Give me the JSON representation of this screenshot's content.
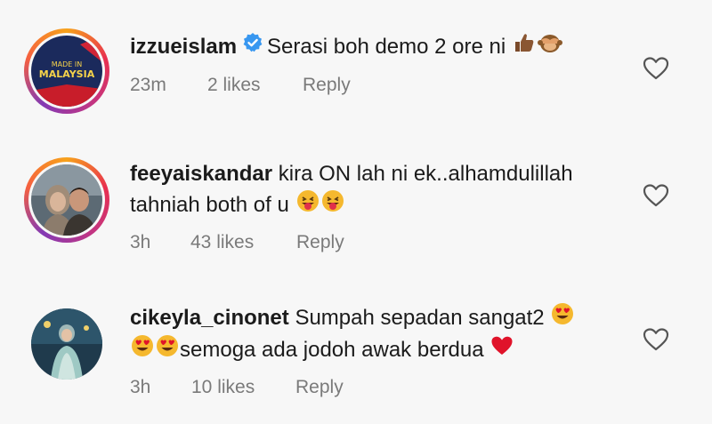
{
  "comments": [
    {
      "username": "izzueislam",
      "verified": true,
      "text_line1": "Serasi boh demo 2 ore ni",
      "text_line2": "",
      "time": "23m",
      "likes": "2 likes",
      "reply": "Reply",
      "avatar_text_top": "MADE IN",
      "avatar_text_mid": "MALAYSIA",
      "emojis": [
        "thumbs-up-icon",
        "see-no-evil-monkey-icon"
      ]
    },
    {
      "username": "feeyaiskandar",
      "verified": false,
      "text_line1": "kira ON lah ni ek..alhamdulillah",
      "text_line2": "tahniah both of u",
      "time": "3h",
      "likes": "43 likes",
      "reply": "Reply",
      "emojis": [
        "winking-tongue-face-icon",
        "winking-tongue-face-icon"
      ]
    },
    {
      "username": "cikeyla_cinonet",
      "verified": false,
      "text_line1": "Sumpah sepadan sangat2",
      "text_line2": "semoga ada jodoh awak berdua",
      "time": "3h",
      "likes": "10 likes",
      "reply": "Reply",
      "emojis": [
        "heart-eyes-face-icon",
        "heart-eyes-face-icon",
        "heart-eyes-face-icon",
        "red-heart-icon"
      ]
    }
  ],
  "colors": {
    "text": "#1b1b1b",
    "meta": "#7a7a7a",
    "verified_blue": "#3897f0",
    "emoji_yellow": "#f5b82e",
    "heart_red": "#e0132a"
  }
}
